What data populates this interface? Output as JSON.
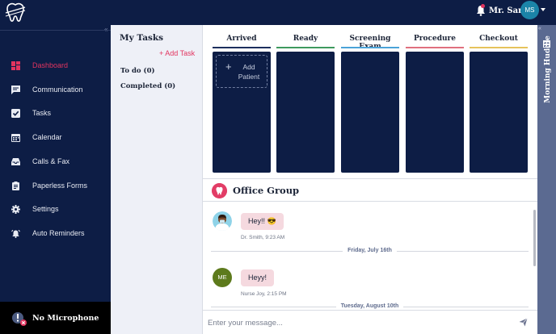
{
  "header": {
    "user_name": "Mr. Sam",
    "user_initials": "MS",
    "avatar_color": "#1b84a8",
    "logo": "tooth-logo",
    "notification_icon": "bell-icon"
  },
  "sidebar": {
    "items": [
      {
        "label": "Dashboard",
        "icon": "dashboard-icon",
        "active": true
      },
      {
        "label": "Communication",
        "icon": "chat-icon"
      },
      {
        "label": "Tasks",
        "icon": "checkbox-icon"
      },
      {
        "label": "Calendar",
        "icon": "calendar-icon"
      },
      {
        "label": "Calls & Fax",
        "icon": "inbox-icon"
      },
      {
        "label": "Paperless Forms",
        "icon": "clipboard-icon"
      },
      {
        "label": "Settings",
        "icon": "gear-icon"
      },
      {
        "label": "Auto Reminders",
        "icon": "alarm-icon"
      }
    ],
    "mic_status": "No Microphone"
  },
  "tasks": {
    "title": "My Tasks",
    "add_label": "+ Add Task",
    "todo": "To do (0)",
    "completed": "Completed (0)"
  },
  "board": {
    "columns": [
      {
        "title": "Arrived",
        "color": "#1d2f5e"
      },
      {
        "title": "Ready",
        "color": "#3f9a5e"
      },
      {
        "title": "Screening Exam",
        "color": "#4aa3d8"
      },
      {
        "title": "Procedure",
        "color": "#e0707e"
      },
      {
        "title": "Checkout",
        "color": "#e6c35c"
      }
    ],
    "add_patient": "Add Patient"
  },
  "chat": {
    "title": "Office Group",
    "messages": [
      {
        "text": "Hey!! 😎",
        "meta": "Dr. Smith, 9:23 AM",
        "avatar": "doctor-avatar"
      },
      {
        "date": "Friday, July 16th"
      },
      {
        "text": "Heyy!",
        "meta": "Nurse Joy, 2:15 PM",
        "initials": "ME",
        "avatar_color": "#5d7a1c"
      },
      {
        "date": "Tuesday, August 10th"
      }
    ],
    "placeholder": "Enter your message..."
  },
  "huddle": {
    "label": "Morning Huddle"
  },
  "colors": {
    "navy": "#0d1d45",
    "accent": "#e2345f",
    "panel": "#eef0f7",
    "huddle": "#5b6a91"
  }
}
